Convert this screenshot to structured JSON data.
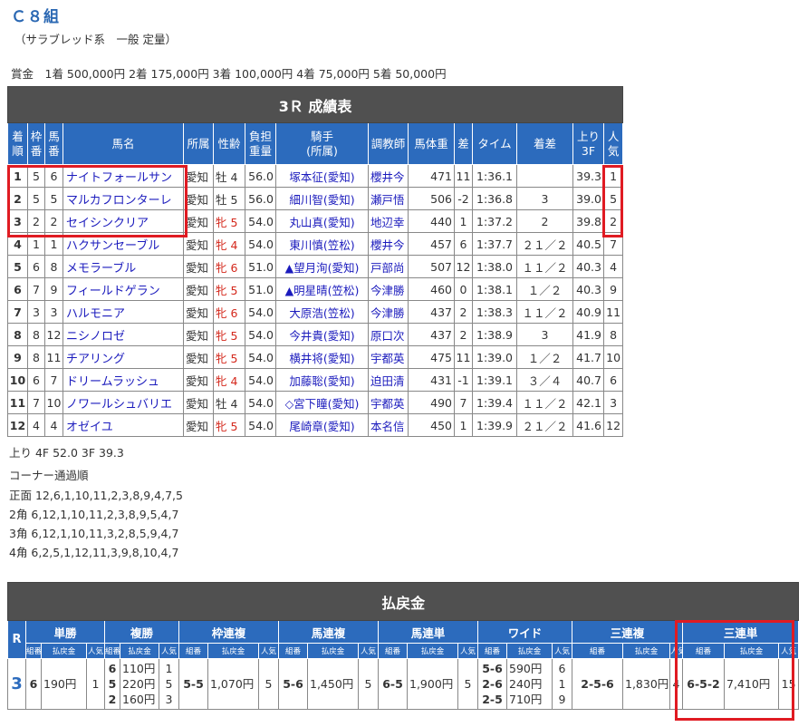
{
  "header": {
    "race_class": "Ｃ８組",
    "race_sub": "（サラブレッド系　一般 定量）",
    "prize_line": "賞金　1着 500,000円 2着 175,000円 3着 100,000円 4着 75,000円 5着 50,000円"
  },
  "results": {
    "title": "3Ｒ 成績表",
    "columns": [
      "着順",
      "枠番",
      "馬番",
      "馬名",
      "所属",
      "性齢",
      "負担重量",
      "騎手(所属)",
      "調教師",
      "馬体重",
      "差",
      "タイム",
      "着差",
      "上り3F",
      "人気"
    ],
    "col_rank_a": "着",
    "col_rank_b": "順",
    "col_waku_a": "枠",
    "col_waku_b": "番",
    "col_uma_a": "馬",
    "col_uma_b": "番",
    "col_weight_a": "負担",
    "col_weight_b": "重量",
    "col_jockey_a": "騎手",
    "col_jockey_b": "(所属)",
    "col_last3f_a": "上り",
    "col_last3f_b": "3F",
    "col_pop_a": "人",
    "col_pop_b": "気",
    "rows": [
      {
        "rank": "1",
        "waku": "5",
        "uma": "6",
        "name": "ナイトフォールサン",
        "aff": "愛知",
        "sex": "牡",
        "age": "4",
        "wt": "56.0",
        "jockey": "塚本征(愛知)",
        "trainer": "櫻井今",
        "bw": "471",
        "diff": "11",
        "time": "1:36.1",
        "margin": "",
        "last": "39.3",
        "pop": "1"
      },
      {
        "rank": "2",
        "waku": "5",
        "uma": "5",
        "name": "マルカフロンターレ",
        "aff": "愛知",
        "sex": "牡",
        "age": "5",
        "wt": "56.0",
        "jockey": "細川智(愛知)",
        "trainer": "瀬戸悟",
        "bw": "506",
        "diff": "-2",
        "time": "1:36.8",
        "margin": "3",
        "last": "39.0",
        "pop": "5"
      },
      {
        "rank": "3",
        "waku": "2",
        "uma": "2",
        "name": "セイシンクリア",
        "aff": "愛知",
        "sex": "牝",
        "age": "5",
        "wt": "54.0",
        "jockey": "丸山真(愛知)",
        "trainer": "地辺幸",
        "bw": "440",
        "diff": "1",
        "time": "1:37.2",
        "margin": "2",
        "last": "39.8",
        "pop": "2"
      },
      {
        "rank": "4",
        "waku": "1",
        "uma": "1",
        "name": "ハクサンセーブル",
        "aff": "愛知",
        "sex": "牝",
        "age": "4",
        "wt": "54.0",
        "jockey": "東川慎(笠松)",
        "trainer": "櫻井今",
        "bw": "457",
        "diff": "6",
        "time": "1:37.7",
        "margin": "２１／２",
        "last": "40.5",
        "pop": "7"
      },
      {
        "rank": "5",
        "waku": "6",
        "uma": "8",
        "name": "メモラーブル",
        "aff": "愛知",
        "sex": "牝",
        "age": "6",
        "wt": "51.0",
        "jockey": "▲望月洵(愛知)",
        "trainer": "戸部尚",
        "bw": "507",
        "diff": "12",
        "time": "1:38.0",
        "margin": "１１／２",
        "last": "40.3",
        "pop": "4"
      },
      {
        "rank": "6",
        "waku": "7",
        "uma": "9",
        "name": "フィールドゲラン",
        "aff": "愛知",
        "sex": "牝",
        "age": "5",
        "wt": "51.0",
        "jockey": "▲明星晴(笠松)",
        "trainer": "今津勝",
        "bw": "460",
        "diff": "0",
        "time": "1:38.1",
        "margin": "１／２",
        "last": "40.3",
        "pop": "9"
      },
      {
        "rank": "7",
        "waku": "3",
        "uma": "3",
        "name": "ハルモニア",
        "aff": "愛知",
        "sex": "牝",
        "age": "6",
        "wt": "54.0",
        "jockey": "大原浩(笠松)",
        "trainer": "今津勝",
        "bw": "437",
        "diff": "2",
        "time": "1:38.3",
        "margin": "１１／２",
        "last": "40.9",
        "pop": "11"
      },
      {
        "rank": "8",
        "waku": "8",
        "uma": "12",
        "name": "ニシノロゼ",
        "aff": "愛知",
        "sex": "牝",
        "age": "5",
        "wt": "54.0",
        "jockey": "今井貴(愛知)",
        "trainer": "原口次",
        "bw": "437",
        "diff": "2",
        "time": "1:38.9",
        "margin": "3",
        "last": "41.9",
        "pop": "8"
      },
      {
        "rank": "9",
        "waku": "8",
        "uma": "11",
        "name": "チアリング",
        "aff": "愛知",
        "sex": "牝",
        "age": "5",
        "wt": "54.0",
        "jockey": "横井将(愛知)",
        "trainer": "宇都英",
        "bw": "475",
        "diff": "11",
        "time": "1:39.0",
        "margin": "１／２",
        "last": "41.7",
        "pop": "10"
      },
      {
        "rank": "10",
        "waku": "6",
        "uma": "7",
        "name": "ドリームラッシュ",
        "aff": "愛知",
        "sex": "牝",
        "age": "4",
        "wt": "54.0",
        "jockey": "加藤聡(愛知)",
        "trainer": "迫田清",
        "bw": "431",
        "diff": "-1",
        "time": "1:39.1",
        "margin": "３／４",
        "last": "40.7",
        "pop": "6"
      },
      {
        "rank": "11",
        "waku": "7",
        "uma": "10",
        "name": "ノワールシュバリエ",
        "aff": "愛知",
        "sex": "牡",
        "age": "4",
        "wt": "54.0",
        "jockey": "◇宮下瞳(愛知)",
        "trainer": "宇都英",
        "bw": "490",
        "diff": "7",
        "time": "1:39.4",
        "margin": "１１／２",
        "last": "42.1",
        "pop": "3"
      },
      {
        "rank": "12",
        "waku": "4",
        "uma": "4",
        "name": "オゼイユ",
        "aff": "愛知",
        "sex": "牝",
        "age": "5",
        "wt": "54.0",
        "jockey": "尾崎章(愛知)",
        "trainer": "本名信",
        "bw": "450",
        "diff": "1",
        "time": "1:39.9",
        "margin": "２１／２",
        "last": "41.6",
        "pop": "12"
      }
    ]
  },
  "race_info": {
    "last_times": "上り 4F 52.0 3F 39.3",
    "corner_title": "コーナー通過順",
    "corners": [
      "正面 12,6,1,10,11,2,3,8,9,4,7,5",
      " 2角 6,12,1,10,11,2,3,8,9,5,4,7",
      " 3角 6,12,1,10,11,3,2,8,5,9,4,7",
      " 4角 6,2,5,1,12,11,3,9,8,10,4,7"
    ]
  },
  "payout": {
    "title": "払戻金",
    "race_label": "R",
    "race_no": "3",
    "sub_combo": "組番",
    "sub_amount": "払戻金",
    "sub_pop": "人気",
    "categories": [
      "単勝",
      "複勝",
      "枠連複",
      "馬連複",
      "馬連単",
      "ワイド",
      "三連複",
      "三連単"
    ],
    "tansho": {
      "combo": "6",
      "amount": "190円",
      "pop": "1"
    },
    "fukusho": {
      "combo": [
        "6",
        "5",
        "2"
      ],
      "amount": [
        "110円",
        "220円",
        "160円"
      ],
      "pop": [
        "1",
        "5",
        "3"
      ]
    },
    "wakuren": {
      "combo": "5-5",
      "amount": "1,070円",
      "pop": "5"
    },
    "umarenpuku": {
      "combo": "5-6",
      "amount": "1,450円",
      "pop": "5"
    },
    "umarentan": {
      "combo": "6-5",
      "amount": "1,900円",
      "pop": "5"
    },
    "wide": {
      "combo": [
        "5-6",
        "2-6",
        "2-5"
      ],
      "amount": [
        "590円",
        "240円",
        "710円"
      ],
      "pop": [
        "6",
        "1",
        "9"
      ]
    },
    "sanrenpuku": {
      "combo": "2-5-6",
      "amount": "1,830円",
      "pop": "4"
    },
    "sanrentan": {
      "combo": "6-5-2",
      "amount": "7,410円",
      "pop": "15"
    }
  },
  "colors": {
    "header_blue": "#2c6bbd",
    "title_gray": "#505050",
    "link_blue": "#1b1bbd",
    "female_red": "#d4281c",
    "highlight_red": "#e01b22"
  }
}
